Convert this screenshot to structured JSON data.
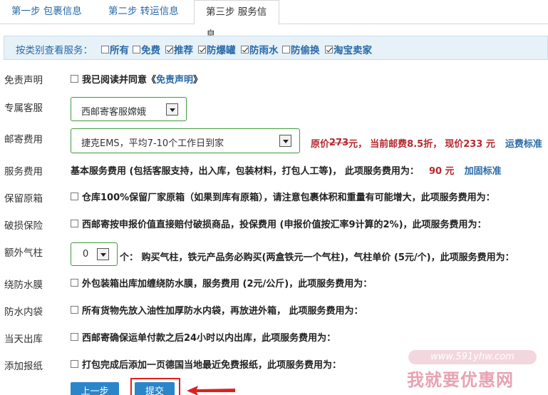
{
  "tabs": [
    {
      "label": "第一步 包裹信息"
    },
    {
      "label": "第二步 转运信息"
    },
    {
      "label": "第三步 服务信息"
    }
  ],
  "filter": {
    "label": "按类别查看服务：",
    "items": [
      {
        "label": "所有",
        "checked": false
      },
      {
        "label": "免费",
        "checked": false
      },
      {
        "label": "推荐",
        "checked": true
      },
      {
        "label": "防爆罐",
        "checked": true
      },
      {
        "label": "防雨水",
        "checked": true
      },
      {
        "label": "防偷换",
        "checked": false
      },
      {
        "label": "淘宝卖家",
        "checked": true
      }
    ]
  },
  "disclaimer": {
    "label": "免责声明",
    "text": "我已阅读并同意《",
    "link": "免责声明",
    "suffix": "》"
  },
  "agent": {
    "label": "专属客服",
    "value": "西邮寄客服嫦娥"
  },
  "postage": {
    "label": "邮寄费用",
    "value": "捷克EMS，平均7-10个工作日到家",
    "orig_prefix": "原价",
    "orig_price": "273",
    "orig_suffix": "元，",
    "discount": "当前邮费8.5折，",
    "now": "现价233 元",
    "standard_link": "运费标准"
  },
  "service_fee": {
    "label": "服务费用",
    "text": "基本服务费用 (包括客服支持，出入库，包装材料，打包人工等)， 此项服务费用为：",
    "price": "90 元",
    "link": "加固标准"
  },
  "rows": [
    {
      "label": "保留原箱",
      "text": "仓库100%保留厂家原箱（如果到库有原箱），请注意包裹体积和重量有可能增大，此项服务费用为："
    },
    {
      "label": "破损保险",
      "text": "西邮寄按申报价值直接赔付破损商品，投保费用 (申报价值按汇率9计算的2%)，此项服务费用为："
    },
    {
      "label": "绕防水膜",
      "text": "外包装箱出库加缠绕防水膜，服务费用 (2元/公斤)，此项服务费用为："
    },
    {
      "label": "防水内袋",
      "text": "所有货物先放入油性加厚防水内袋，再放进外箱， 此项服务费用为："
    },
    {
      "label": "当天出库",
      "text": "西邮寄确保运单付款之后24小时以内出库，此项服务费用为："
    },
    {
      "label": "添加报纸",
      "text": "打包完成后添加一页德国当地最近免费报纸，此项服务费用为："
    }
  ],
  "air_column": {
    "label": "额外气柱",
    "value": "0",
    "text": "个： 购买气柱，铁元产品务必购买(两盒铁元一个气柱)，气柱单价 (5元/个)，此项服务费用为："
  },
  "buttons": {
    "prev": "上一步",
    "submit": "提交"
  },
  "watermark": {
    "url": "www.591yhw.com",
    "name": "我就要优惠网"
  }
}
